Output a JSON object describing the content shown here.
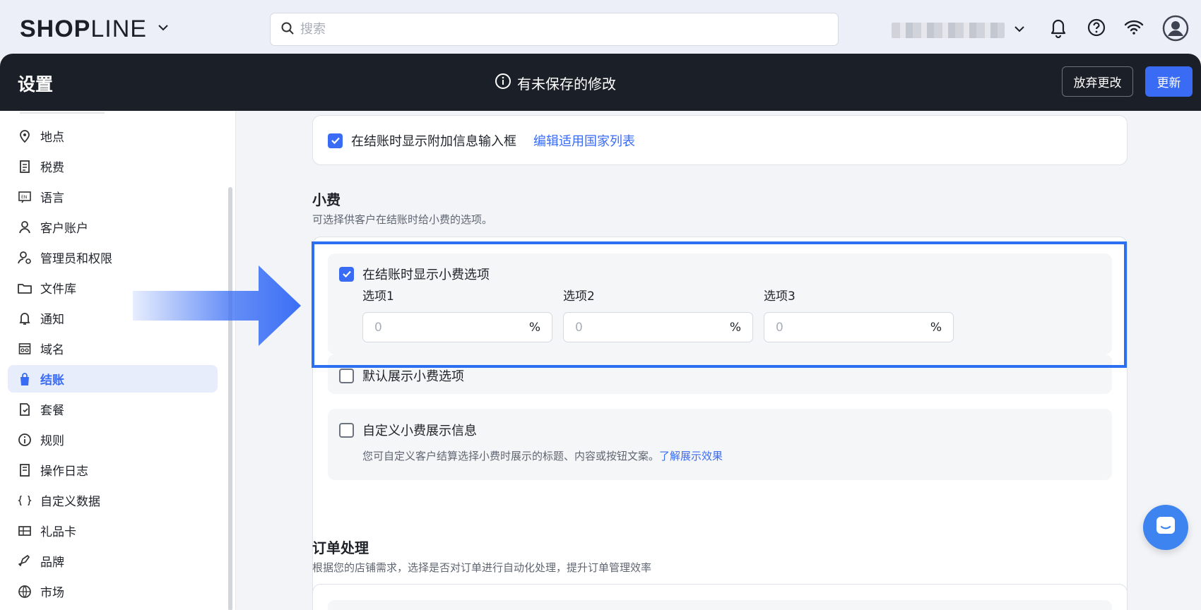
{
  "topbar": {
    "logo_bold": "SHOP",
    "logo_thin": "LINE",
    "search_placeholder": "搜索",
    "icons": [
      "chevron-down-icon",
      "search-icon",
      "bell-icon",
      "help-icon",
      "wifi-icon",
      "avatar-icon"
    ]
  },
  "header": {
    "title": "设置",
    "unsaved": "有未保存的修改",
    "discard_label": "放弃更改",
    "update_label": "更新"
  },
  "sidebar": {
    "items": [
      {
        "label": "地点",
        "icon": "location-icon"
      },
      {
        "label": "税费",
        "icon": "tax-icon"
      },
      {
        "label": "语言",
        "icon": "language-icon"
      },
      {
        "label": "客户账户",
        "icon": "user-icon"
      },
      {
        "label": "管理员和权限",
        "icon": "admin-icon"
      },
      {
        "label": "文件库",
        "icon": "folder-icon"
      },
      {
        "label": "通知",
        "icon": "bell-icon"
      },
      {
        "label": "域名",
        "icon": "domain-icon"
      },
      {
        "label": "结账",
        "icon": "bag-icon",
        "active": true
      },
      {
        "label": "套餐",
        "icon": "plan-icon"
      },
      {
        "label": "规则",
        "icon": "info-icon"
      },
      {
        "label": "操作日志",
        "icon": "log-icon"
      },
      {
        "label": "自定义数据",
        "icon": "custom-data-icon"
      },
      {
        "label": "礼品卡",
        "icon": "gift-card-icon"
      },
      {
        "label": "品牌",
        "icon": "brand-icon"
      },
      {
        "label": "市场",
        "icon": "globe-icon"
      }
    ]
  },
  "main": {
    "extra_info": {
      "checkbox_label": "在结账时显示附加信息输入框",
      "link": "编辑适用国家列表",
      "checked": true
    },
    "tips": {
      "title": "小费",
      "desc": "可选择供客户在结账时给小费的选项。",
      "show_tips": {
        "label": "在结账时显示小费选项",
        "checked": true
      },
      "options": [
        {
          "label": "选项1",
          "placeholder": "0",
          "unit": "%"
        },
        {
          "label": "选项2",
          "placeholder": "0",
          "unit": "%"
        },
        {
          "label": "选项3",
          "placeholder": "0",
          "unit": "%"
        }
      ],
      "default_show": {
        "label": "默认展示小费选项",
        "checked": false
      },
      "custom_info": {
        "label": "自定义小费展示信息",
        "checked": false,
        "desc": "您可自定义客户结算选择小费时展示的标题、内容或按钮文案。",
        "link": "了解展示效果"
      }
    },
    "order_processing": {
      "title": "订单处理",
      "desc": "根据您的店铺需求，选择是否对订单进行自动化处理，提升订单管理效率"
    }
  },
  "colors": {
    "accent": "#3a6bf5",
    "dark": "#1b1f27",
    "highlight": "#2c6ff1"
  }
}
